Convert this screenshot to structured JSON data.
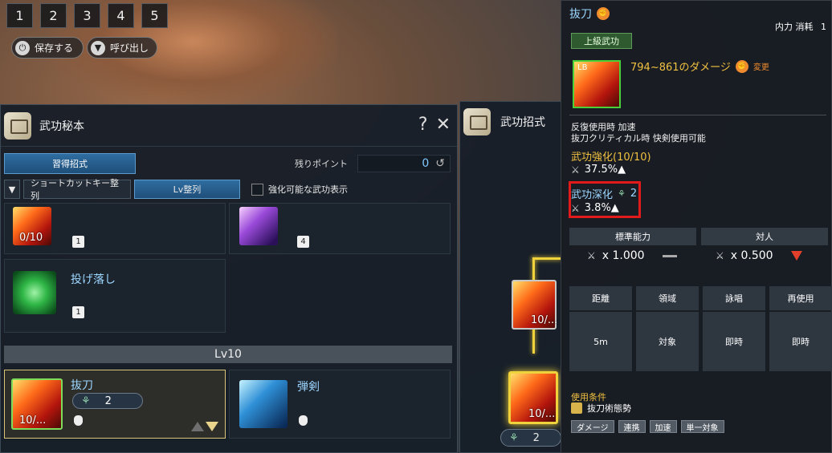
{
  "hotkeys": [
    "1",
    "2",
    "3",
    "4",
    "5"
  ],
  "presets": {
    "save": "保存する",
    "load": "呼び出し"
  },
  "left_panel": {
    "title": "武功秘本",
    "help": "?",
    "close": "✕",
    "tab_active": "習得招式",
    "points_label": "残りポイント",
    "points_value": "0",
    "filter": {
      "shortcut_sort": "ショートカットキー整列",
      "lv_sort": "Lv整列",
      "enhance_only": "強化可能な武功表示"
    },
    "skills_top": [
      {
        "name": "",
        "level": "0/10",
        "badge": "1"
      },
      {
        "name": "",
        "level": "",
        "badge": "4"
      },
      {
        "name": "投げ落し",
        "level": "",
        "badge": "1"
      }
    ],
    "lv_header": "Lv10",
    "skills_lv10": [
      {
        "name": "抜刀",
        "level": "10/...",
        "deep": "2"
      },
      {
        "name": "弾剣",
        "level": ""
      }
    ]
  },
  "mid_panel": {
    "title": "武功招式",
    "node1_level": "10/...",
    "node2_level": "10/...",
    "node2_deep": "2"
  },
  "tooltip": {
    "title": "抜刀",
    "cost_label": "内力 消耗",
    "cost_value": "1",
    "grade": "上級武功",
    "icon_label": "LB",
    "damage": "794~861のダメージ",
    "change": "変更",
    "desc_line1": "反復使用時 加速",
    "desc_line2": "抜刀クリティカル時 快剣使用可能",
    "enhance_label": "武功強化(10/10)",
    "enhance_value": "37.5%▲",
    "deep_label": "武功深化",
    "deep_value": "2",
    "deep_stat": "3.8%▲",
    "stats": {
      "standard_label": "標準能力",
      "standard_value": "x 1.000",
      "pvp_label": "対人",
      "pvp_value": "x 0.500"
    },
    "grid_heads": [
      "距離",
      "領域",
      "詠唱",
      "再使用"
    ],
    "grid_vals": [
      "5m",
      "対象",
      "即時",
      "即時"
    ],
    "condition_label": "使用条件",
    "condition_value": "抜刀術態勢",
    "tags": [
      "ダメージ",
      "連携",
      "加速",
      "単一対象"
    ]
  },
  "colors": {
    "accent": "#9cd6ff",
    "gold": "#f0c040",
    "highlight": "#e21a1a"
  }
}
